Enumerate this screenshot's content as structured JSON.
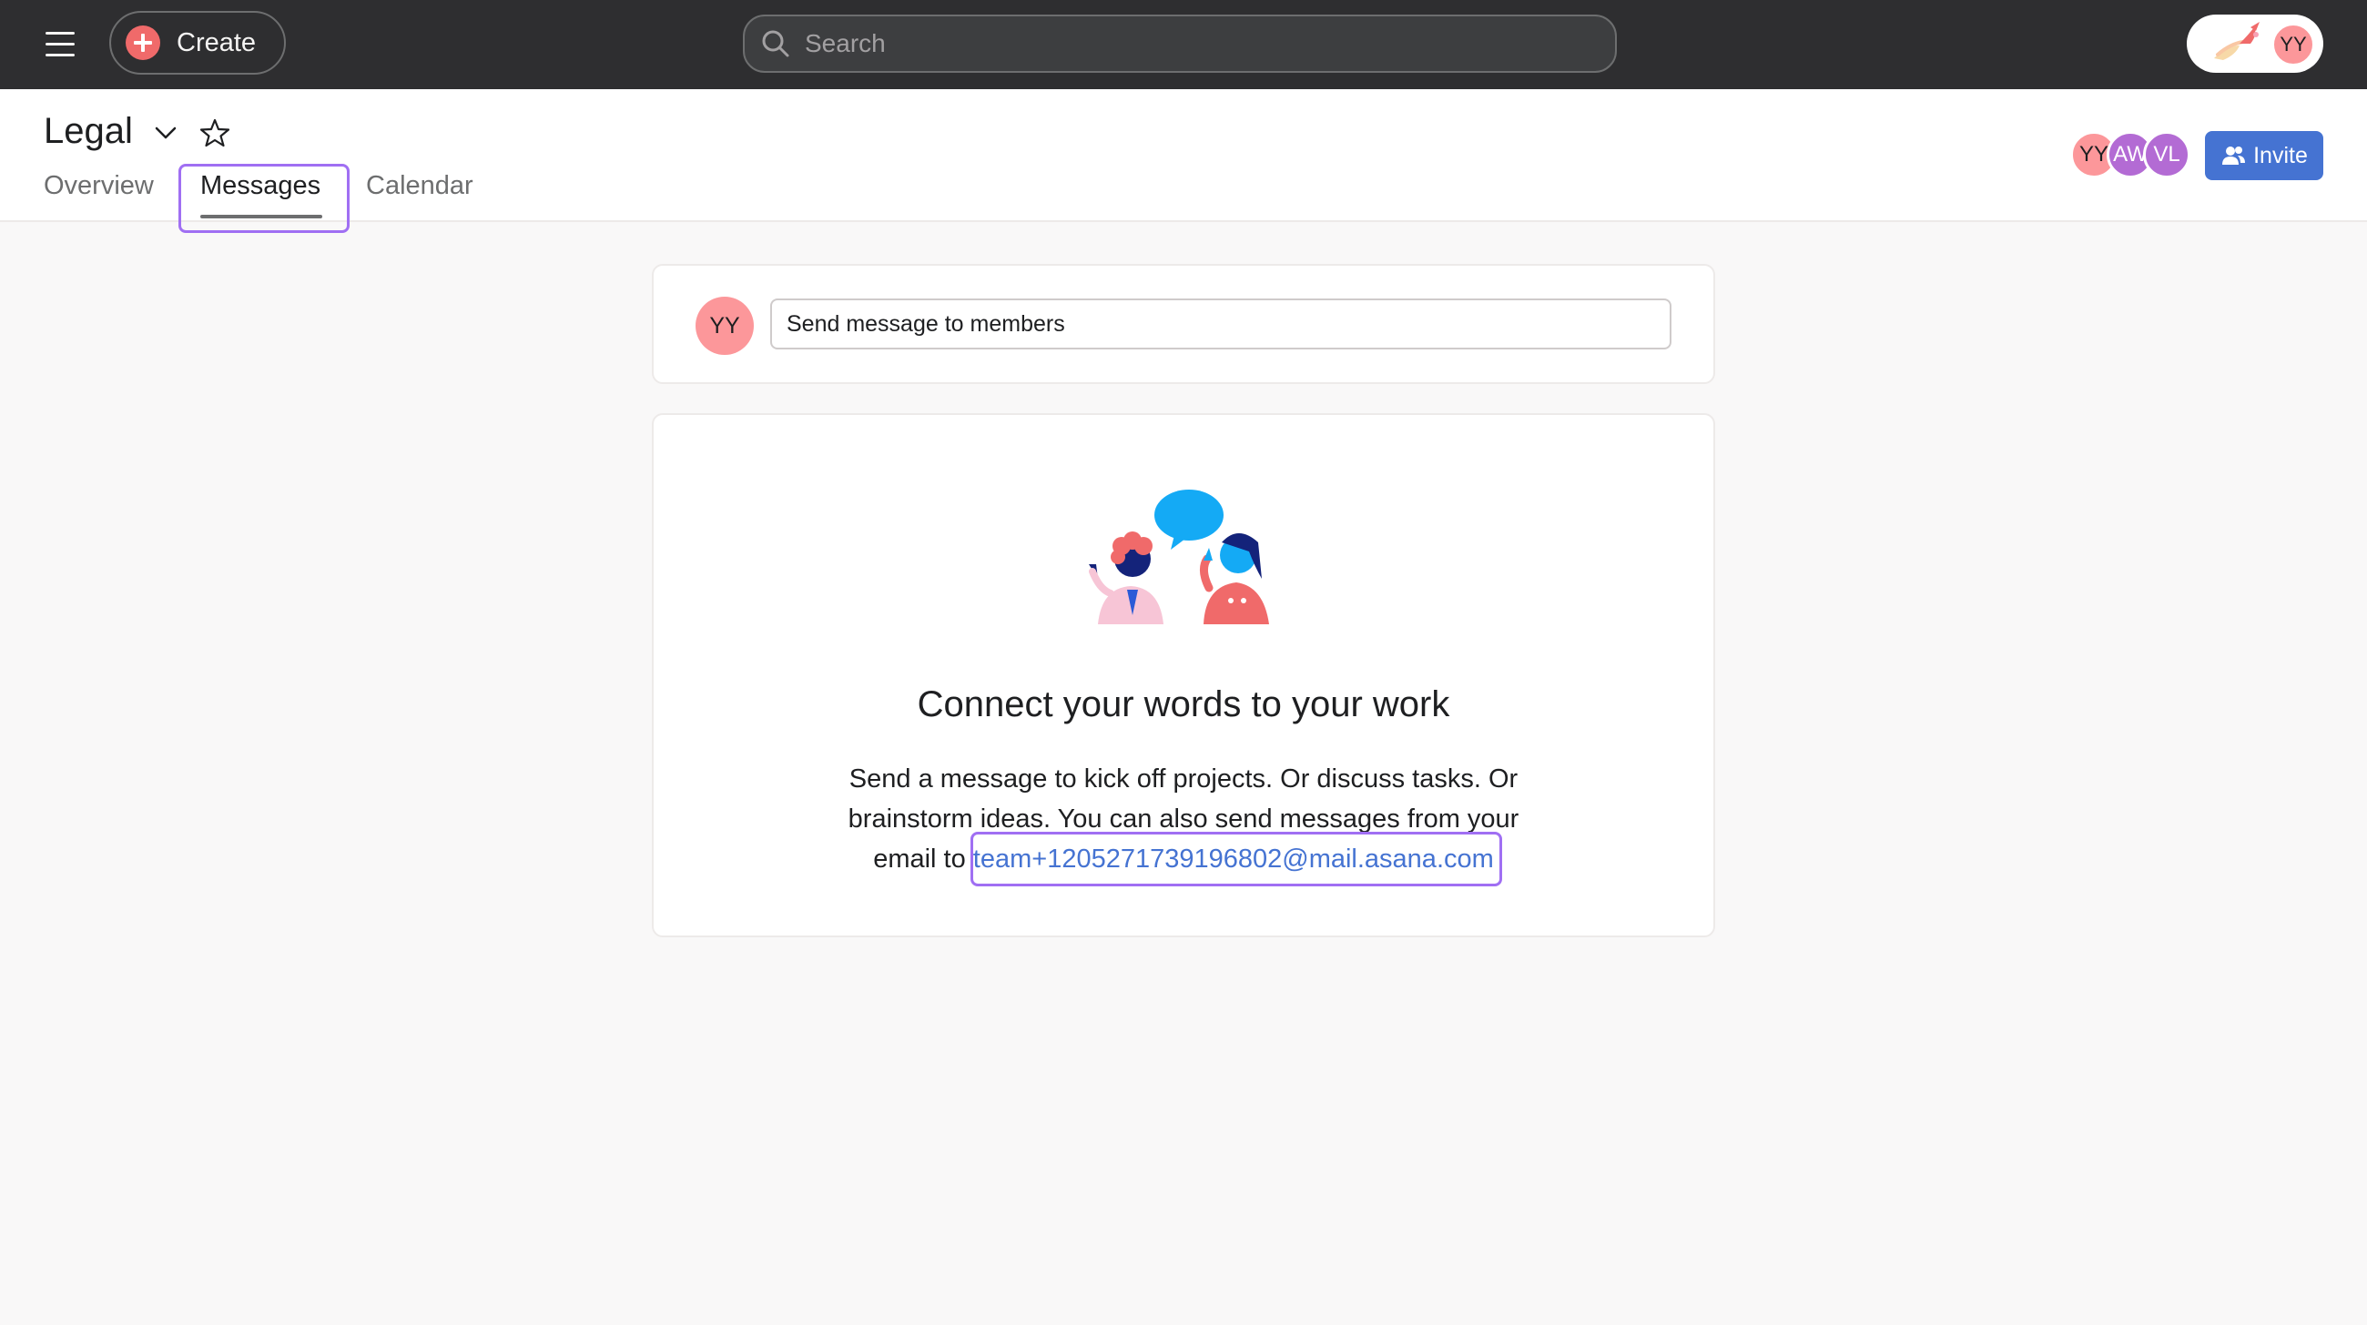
{
  "topbar": {
    "create_label": "Create",
    "search_placeholder": "Search",
    "user_initials": "YY"
  },
  "project": {
    "title": "Legal",
    "tabs": [
      {
        "label": "Overview",
        "active": false
      },
      {
        "label": "Messages",
        "active": true
      },
      {
        "label": "Calendar",
        "active": false
      }
    ],
    "members": [
      "YY",
      "AW",
      "VL"
    ],
    "invite_label": "Invite"
  },
  "composer": {
    "avatar_initials": "YY",
    "placeholder": "Send message to members"
  },
  "empty_state": {
    "heading": "Connect your words to your work",
    "body": "Send a message to kick off projects. Or discuss tasks. Or brainstorm ideas. You can also send messages from your email to",
    "email": "team+1205271739196802@mail.asana.com"
  },
  "colors": {
    "topbar_bg": "#2e2e30",
    "create_accent": "#f06a6a",
    "invite_button": "#4573d2",
    "link": "#4573d2",
    "highlight_outline": "#a06ff3",
    "avatar_yy": "#fc979a",
    "avatar_purple": "#b36bd4"
  }
}
